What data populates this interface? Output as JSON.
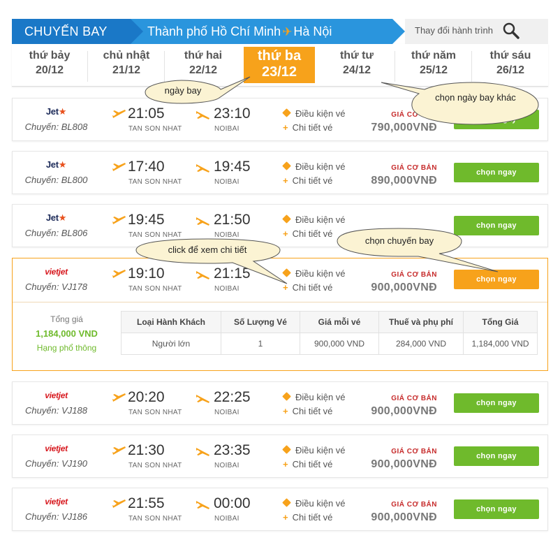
{
  "header": {
    "title": "CHUYẾN BAY",
    "origin": "Thành phố Hồ Chí Minh",
    "destination": "Hà Nội",
    "change_label": "Thay đổi hành trình"
  },
  "dates": [
    {
      "dow": "thứ bảy",
      "date": "20/12"
    },
    {
      "dow": "chủ nhật",
      "date": "21/12"
    },
    {
      "dow": "thứ hai",
      "date": "22/12"
    },
    {
      "dow": "thứ ba",
      "date": "23/12",
      "active": true
    },
    {
      "dow": "thứ tư",
      "date": "24/12"
    },
    {
      "dow": "thứ năm",
      "date": "25/12"
    },
    {
      "dow": "thứ sáu",
      "date": "26/12"
    }
  ],
  "labels": {
    "flight_prefix": "Chuyến:",
    "conditions": "Điều kiện vé",
    "details": "Chi tiết vé",
    "price_label": "GIÁ CƠ BẢN",
    "select": "chọn ngay"
  },
  "flights": [
    {
      "airline": "Jet",
      "airline_star": "★",
      "code": "BL808",
      "dep": "21:05",
      "arr": "23:10",
      "dep_apt": "TAN SON NHAT",
      "arr_apt": "NOIBAI",
      "price": "790,000VNĐ"
    },
    {
      "airline": "Jet",
      "airline_star": "★",
      "code": "BL800",
      "dep": "17:40",
      "arr": "19:45",
      "dep_apt": "TAN SON NHAT",
      "arr_apt": "NOIBAI",
      "price": "890,000VNĐ"
    },
    {
      "airline": "Jet",
      "airline_star": "★",
      "code": "BL806",
      "dep": "19:45",
      "arr": "21:50",
      "dep_apt": "TAN SON NHAT",
      "arr_apt": "NOIBAI",
      "price": ""
    },
    {
      "airline": "vietjet",
      "code": "VJ178",
      "dep": "19:10",
      "arr": "21:15",
      "dep_apt": "TAN SON NHAT",
      "arr_apt": "NOIBAI",
      "price": "900,000VNĐ"
    },
    {
      "airline": "vietjet",
      "code": "VJ188",
      "dep": "20:20",
      "arr": "22:25",
      "dep_apt": "TAN SON NHAT",
      "arr_apt": "NOIBAI",
      "price": "900,000VNĐ"
    },
    {
      "airline": "vietjet",
      "code": "VJ190",
      "dep": "21:30",
      "arr": "23:35",
      "dep_apt": "TAN SON NHAT",
      "arr_apt": "NOIBAI",
      "price": "900,000VNĐ"
    },
    {
      "airline": "vietjet",
      "code": "VJ186",
      "dep": "21:55",
      "arr": "00:00",
      "dep_apt": "TAN SON NHAT",
      "arr_apt": "NOIBAI",
      "price": "900,000VNĐ"
    }
  ],
  "selected_detail": {
    "total_label": "Tổng giá",
    "total": "1,184,000 VND",
    "class": "Hạng phổ thông",
    "columns": [
      "Loại Hành Khách",
      "Số Lượng Vé",
      "Giá mỗi vé",
      "Thuế và phụ phí",
      "Tổng Giá"
    ],
    "rows": [
      [
        "Người lớn",
        "1",
        "900,000 VND",
        "284,000 VND",
        "1,184,000 VND"
      ]
    ]
  },
  "callouts": {
    "flight_day": "ngày bay",
    "other_day": "chọn ngày bay khác",
    "click_details": "click để xem chi tiết",
    "choose_flight": "chọn chuyến bay"
  },
  "colors": {
    "header_dark": "#1a78c7",
    "header_light": "#2a95dd",
    "orange": "#f7a21b",
    "green": "#6fba2c",
    "price_red": "#c62a2a"
  }
}
